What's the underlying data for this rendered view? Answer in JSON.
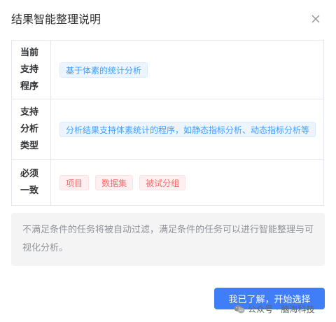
{
  "dialog": {
    "title": "结果智能整理说明",
    "close_icon": "close-icon"
  },
  "table": {
    "rows": [
      {
        "label": "当前支持程序",
        "tags": [
          {
            "text": "基于体素的统计分析",
            "color": "blue"
          }
        ]
      },
      {
        "label": "支持分析类型",
        "tags": [
          {
            "text": "分析结果支持体素统计的程序，如静态指标分析、动态指标分析等",
            "color": "blue"
          }
        ]
      },
      {
        "label": "必须一致",
        "tags": [
          {
            "text": "项目",
            "color": "red"
          },
          {
            "text": "数据集",
            "color": "red"
          },
          {
            "text": "被试分组",
            "color": "red"
          }
        ]
      }
    ]
  },
  "note": "不满足条件的任务将被自动过滤，满足条件的任务可以进行智能整理与可视化分析。",
  "footer": {
    "confirm_label": "我已了解，开始选择"
  },
  "watermark": {
    "text": "公众号 · 脑海科技",
    "icon": "wechat-icon"
  },
  "colors": {
    "primary": "#3f7ef7",
    "tag_blue_text": "#409eff",
    "tag_red_text": "#f56c6c"
  }
}
